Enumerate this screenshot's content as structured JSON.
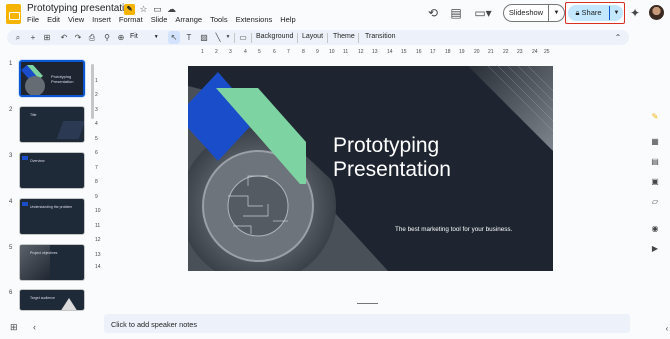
{
  "app": {
    "title": "Prototyping presentation",
    "menu": [
      "File",
      "Edit",
      "View",
      "Insert",
      "Format",
      "Slide",
      "Arrange",
      "Tools",
      "Extensions",
      "Help"
    ]
  },
  "header": {
    "slideshow_label": "Slideshow",
    "share_label": "Share"
  },
  "toolbar": {
    "zoom_label": "Fit",
    "background_label": "Background",
    "layout_label": "Layout",
    "theme_label": "Theme",
    "transition_label": "Transition"
  },
  "filmstrip": {
    "slides": [
      {
        "num": "1",
        "text": "Prototyping Presentation"
      },
      {
        "num": "2",
        "text": "Title"
      },
      {
        "num": "3",
        "text": "Overview"
      },
      {
        "num": "4",
        "text": "Understanding the problem"
      },
      {
        "num": "5",
        "text": "Project objectives"
      },
      {
        "num": "6",
        "text": "Target audience"
      }
    ]
  },
  "ruler": {
    "horizontal": [
      "1",
      "2",
      "3",
      "4",
      "5",
      "6",
      "7",
      "8",
      "9",
      "10",
      "11",
      "12",
      "13",
      "14",
      "15",
      "16",
      "17",
      "18",
      "19",
      "20",
      "21",
      "22",
      "23",
      "24",
      "25"
    ],
    "vertical": [
      "1",
      "2",
      "3",
      "4",
      "5",
      "6",
      "7",
      "8",
      "9",
      "10",
      "11",
      "12",
      "13",
      "14"
    ]
  },
  "slide": {
    "title": "Prototyping\nPresentation",
    "subtitle": "The best marketing tool for your business."
  },
  "notes": {
    "placeholder": "Click to add speaker notes"
  },
  "colors": {
    "accent_blue": "#1a4dc9",
    "accent_green": "#7ed3a2",
    "slide_bg": "#1e2530",
    "share_bg": "#c2e7ff",
    "highlight_red": "#d93025"
  }
}
